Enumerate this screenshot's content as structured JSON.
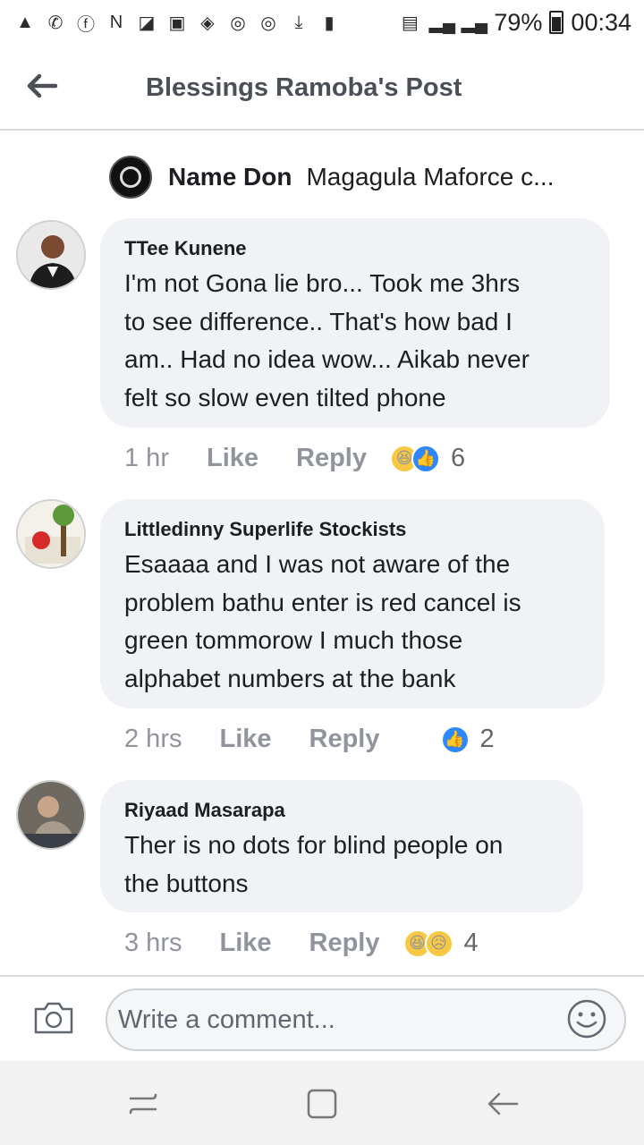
{
  "status_bar": {
    "notification_icons": [
      "alert-icon",
      "whatsapp-icon",
      "facebook-icon",
      "news-icon",
      "gallery-icon",
      "image-icon",
      "wifi-hotspot-icon",
      "sync-icon",
      "sync-icon",
      "download-icon",
      "sd-card-icon"
    ],
    "battery_percent": "79%",
    "time": "00:34"
  },
  "header": {
    "title": "Blessings Ramoba's Post"
  },
  "reply_preview": {
    "name": "Name Don",
    "text": "Magagula Maforce c..."
  },
  "comments": [
    {
      "author": "TTee Kunene",
      "text": "I'm not Gona lie bro... Took me 3hrs\nto see difference.. That's how bad I\nam.. Had no idea wow... Aikab never\nfelt so slow even tilted phone",
      "time": "1 hr",
      "like_label": "Like",
      "reply_label": "Reply",
      "reactions": [
        "haha",
        "like"
      ],
      "reaction_count": "6"
    },
    {
      "author": "Littledinny Superlife Stockists",
      "text": "Esaaaa and I was not aware of the\nproblem bathu enter is red cancel is\ngreen tommorow I much those\nalphabet numbers at the bank",
      "time": "2 hrs",
      "like_label": "Like",
      "reply_label": "Reply",
      "reactions": [
        "like"
      ],
      "reaction_count": "2"
    },
    {
      "author": "Riyaad Masarapa",
      "text": "Ther is no dots for blind people on\nthe buttons",
      "time": "3 hrs",
      "like_label": "Like",
      "reply_label": "Reply",
      "reactions": [
        "haha",
        "sad"
      ],
      "reaction_count": "4"
    }
  ],
  "composer": {
    "placeholder": "Write a comment..."
  },
  "colors": {
    "bubble": "#f0f2f5",
    "meta_text": "#90949c",
    "like_blue": "#2d88ff",
    "haha_yellow": "#f7c842"
  }
}
